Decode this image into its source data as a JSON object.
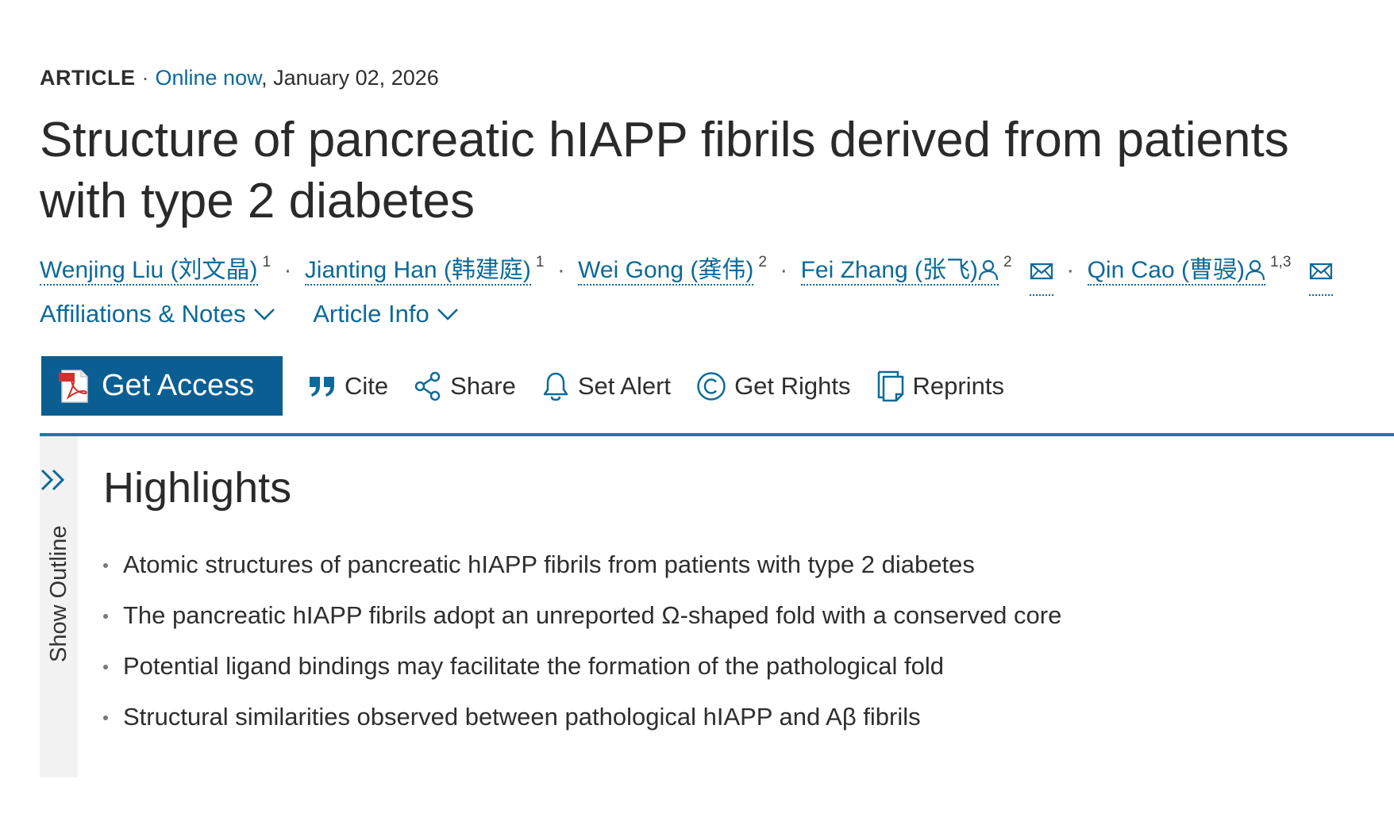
{
  "article": {
    "type": "ARTICLE",
    "separator": "·",
    "online_label": "Online now",
    "date": ", January 02, 2026",
    "title": "Structure of pancreatic hIAPP fibrils derived from patients with type 2 diabetes"
  },
  "authors": [
    {
      "name": "Wenjing Liu (刘文晶)",
      "sup": "1"
    },
    {
      "name": "Jianting Han (韩建庭)",
      "sup": "1"
    },
    {
      "name": "Wei Gong (龚伟)",
      "sup": "2"
    },
    {
      "name": "Fei Zhang (张飞)",
      "sup": "2",
      "corresponding": true
    },
    {
      "name": "Qin Cao (曹骎)",
      "sup": "1,3",
      "corresponding": true
    }
  ],
  "author_separator": "·",
  "disclosures": {
    "affiliations": "Affiliations & Notes",
    "article_info": "Article Info"
  },
  "toolbar": {
    "get_access": "Get Access",
    "cite": "Cite",
    "share": "Share",
    "set_alert": "Set Alert",
    "get_rights": "Get Rights",
    "reprints": "Reprints"
  },
  "outline": {
    "label": "Show Outline"
  },
  "highlights": {
    "heading": "Highlights",
    "items": [
      "Atomic structures of pancreatic hIAPP fibrils from patients with type 2 diabetes",
      "The pancreatic hIAPP fibrils adopt an unreported Ω-shaped fold with a conserved core",
      "Potential ligand bindings may facilitate the formation of the pathological fold",
      "Structural similarities observed between pathological hIAPP and Aβ fibrils"
    ]
  },
  "colors": {
    "link": "#0c6a9a",
    "primary_button": "#0b5e91",
    "divider": "#1f7aa3",
    "rail": "#f2f2f2"
  },
  "icons": {
    "person": "person-icon",
    "mail": "mail-icon",
    "chevron": "chevron-down-icon",
    "pdf": "pdf-icon",
    "quote": "quote-icon",
    "share": "share-icon",
    "bell": "bell-icon",
    "copyright": "copyright-icon",
    "reprints": "reprints-icon",
    "outline": "double-chevron-right-icon"
  }
}
